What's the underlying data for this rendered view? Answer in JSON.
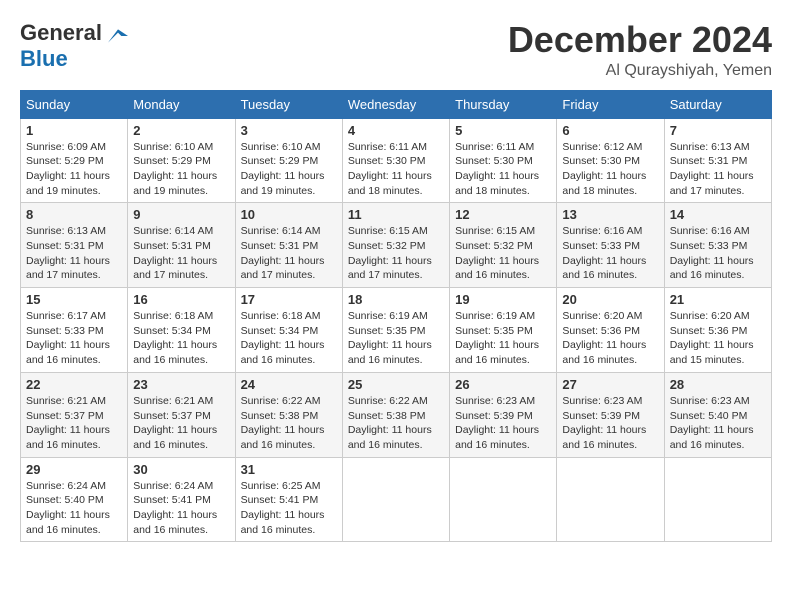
{
  "header": {
    "logo_line1": "General",
    "logo_line2": "Blue",
    "month_title": "December 2024",
    "location": "Al Qurayshiyah, Yemen"
  },
  "calendar": {
    "days_of_week": [
      "Sunday",
      "Monday",
      "Tuesday",
      "Wednesday",
      "Thursday",
      "Friday",
      "Saturday"
    ],
    "weeks": [
      [
        {
          "day": "1",
          "info": "Sunrise: 6:09 AM\nSunset: 5:29 PM\nDaylight: 11 hours\nand 19 minutes."
        },
        {
          "day": "2",
          "info": "Sunrise: 6:10 AM\nSunset: 5:29 PM\nDaylight: 11 hours\nand 19 minutes."
        },
        {
          "day": "3",
          "info": "Sunrise: 6:10 AM\nSunset: 5:29 PM\nDaylight: 11 hours\nand 19 minutes."
        },
        {
          "day": "4",
          "info": "Sunrise: 6:11 AM\nSunset: 5:30 PM\nDaylight: 11 hours\nand 18 minutes."
        },
        {
          "day": "5",
          "info": "Sunrise: 6:11 AM\nSunset: 5:30 PM\nDaylight: 11 hours\nand 18 minutes."
        },
        {
          "day": "6",
          "info": "Sunrise: 6:12 AM\nSunset: 5:30 PM\nDaylight: 11 hours\nand 18 minutes."
        },
        {
          "day": "7",
          "info": "Sunrise: 6:13 AM\nSunset: 5:31 PM\nDaylight: 11 hours\nand 17 minutes."
        }
      ],
      [
        {
          "day": "8",
          "info": "Sunrise: 6:13 AM\nSunset: 5:31 PM\nDaylight: 11 hours\nand 17 minutes."
        },
        {
          "day": "9",
          "info": "Sunrise: 6:14 AM\nSunset: 5:31 PM\nDaylight: 11 hours\nand 17 minutes."
        },
        {
          "day": "10",
          "info": "Sunrise: 6:14 AM\nSunset: 5:31 PM\nDaylight: 11 hours\nand 17 minutes."
        },
        {
          "day": "11",
          "info": "Sunrise: 6:15 AM\nSunset: 5:32 PM\nDaylight: 11 hours\nand 17 minutes."
        },
        {
          "day": "12",
          "info": "Sunrise: 6:15 AM\nSunset: 5:32 PM\nDaylight: 11 hours\nand 16 minutes."
        },
        {
          "day": "13",
          "info": "Sunrise: 6:16 AM\nSunset: 5:33 PM\nDaylight: 11 hours\nand 16 minutes."
        },
        {
          "day": "14",
          "info": "Sunrise: 6:16 AM\nSunset: 5:33 PM\nDaylight: 11 hours\nand 16 minutes."
        }
      ],
      [
        {
          "day": "15",
          "info": "Sunrise: 6:17 AM\nSunset: 5:33 PM\nDaylight: 11 hours\nand 16 minutes."
        },
        {
          "day": "16",
          "info": "Sunrise: 6:18 AM\nSunset: 5:34 PM\nDaylight: 11 hours\nand 16 minutes."
        },
        {
          "day": "17",
          "info": "Sunrise: 6:18 AM\nSunset: 5:34 PM\nDaylight: 11 hours\nand 16 minutes."
        },
        {
          "day": "18",
          "info": "Sunrise: 6:19 AM\nSunset: 5:35 PM\nDaylight: 11 hours\nand 16 minutes."
        },
        {
          "day": "19",
          "info": "Sunrise: 6:19 AM\nSunset: 5:35 PM\nDaylight: 11 hours\nand 16 minutes."
        },
        {
          "day": "20",
          "info": "Sunrise: 6:20 AM\nSunset: 5:36 PM\nDaylight: 11 hours\nand 16 minutes."
        },
        {
          "day": "21",
          "info": "Sunrise: 6:20 AM\nSunset: 5:36 PM\nDaylight: 11 hours\nand 15 minutes."
        }
      ],
      [
        {
          "day": "22",
          "info": "Sunrise: 6:21 AM\nSunset: 5:37 PM\nDaylight: 11 hours\nand 16 minutes."
        },
        {
          "day": "23",
          "info": "Sunrise: 6:21 AM\nSunset: 5:37 PM\nDaylight: 11 hours\nand 16 minutes."
        },
        {
          "day": "24",
          "info": "Sunrise: 6:22 AM\nSunset: 5:38 PM\nDaylight: 11 hours\nand 16 minutes."
        },
        {
          "day": "25",
          "info": "Sunrise: 6:22 AM\nSunset: 5:38 PM\nDaylight: 11 hours\nand 16 minutes."
        },
        {
          "day": "26",
          "info": "Sunrise: 6:23 AM\nSunset: 5:39 PM\nDaylight: 11 hours\nand 16 minutes."
        },
        {
          "day": "27",
          "info": "Sunrise: 6:23 AM\nSunset: 5:39 PM\nDaylight: 11 hours\nand 16 minutes."
        },
        {
          "day": "28",
          "info": "Sunrise: 6:23 AM\nSunset: 5:40 PM\nDaylight: 11 hours\nand 16 minutes."
        }
      ],
      [
        {
          "day": "29",
          "info": "Sunrise: 6:24 AM\nSunset: 5:40 PM\nDaylight: 11 hours\nand 16 minutes."
        },
        {
          "day": "30",
          "info": "Sunrise: 6:24 AM\nSunset: 5:41 PM\nDaylight: 11 hours\nand 16 minutes."
        },
        {
          "day": "31",
          "info": "Sunrise: 6:25 AM\nSunset: 5:41 PM\nDaylight: 11 hours\nand 16 minutes."
        },
        {
          "day": "",
          "info": ""
        },
        {
          "day": "",
          "info": ""
        },
        {
          "day": "",
          "info": ""
        },
        {
          "day": "",
          "info": ""
        }
      ]
    ]
  }
}
